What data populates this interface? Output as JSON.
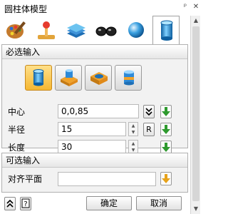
{
  "window": {
    "title": "圆柱体模型",
    "pin_symbol": "ᵖ",
    "close_symbol": "✕"
  },
  "tabs": [
    {
      "icon": "palette-icon"
    },
    {
      "icon": "joystick-icon"
    },
    {
      "icon": "layers-icon"
    },
    {
      "icon": "glasses-icon"
    },
    {
      "icon": "sphere-icon"
    },
    {
      "icon": "cylinder-icon",
      "active": true
    }
  ],
  "required": {
    "title": "必选输入",
    "styles": [
      "cylinder-style",
      "box-boss-style",
      "box-pocket-style",
      "cylinder-stack-style"
    ],
    "center_label": "中心",
    "center_value": "0,0,85",
    "radius_label": "半径",
    "radius_value": "15",
    "radius_button": "R",
    "length_label": "长度",
    "length_value": "30"
  },
  "optional": {
    "title": "可选输入",
    "align_label": "对齐平面",
    "align_value": ""
  },
  "footer": {
    "ok": "确定",
    "cancel": "取消"
  },
  "colors": {
    "accent_green": "#2e9a2e",
    "accent_orange": "#e7a21a"
  }
}
